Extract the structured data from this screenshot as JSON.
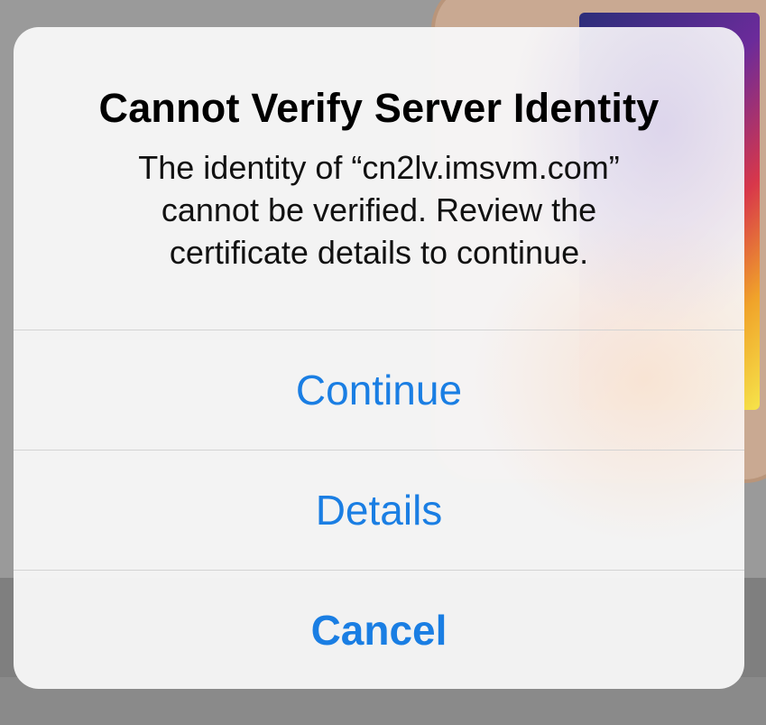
{
  "alert": {
    "title": "Cannot Verify Server Identity",
    "message_lines": [
      "The identity of “cn2lv.imsvm.com”",
      "cannot be verified. Review the",
      "certificate details to continue."
    ],
    "buttons": {
      "continue": "Continue",
      "details": "Details",
      "cancel": "Cancel"
    }
  },
  "colors": {
    "button_text": "#1a7ee3",
    "separator": "#d3d3d3",
    "alert_background": "#f6f6f6"
  }
}
